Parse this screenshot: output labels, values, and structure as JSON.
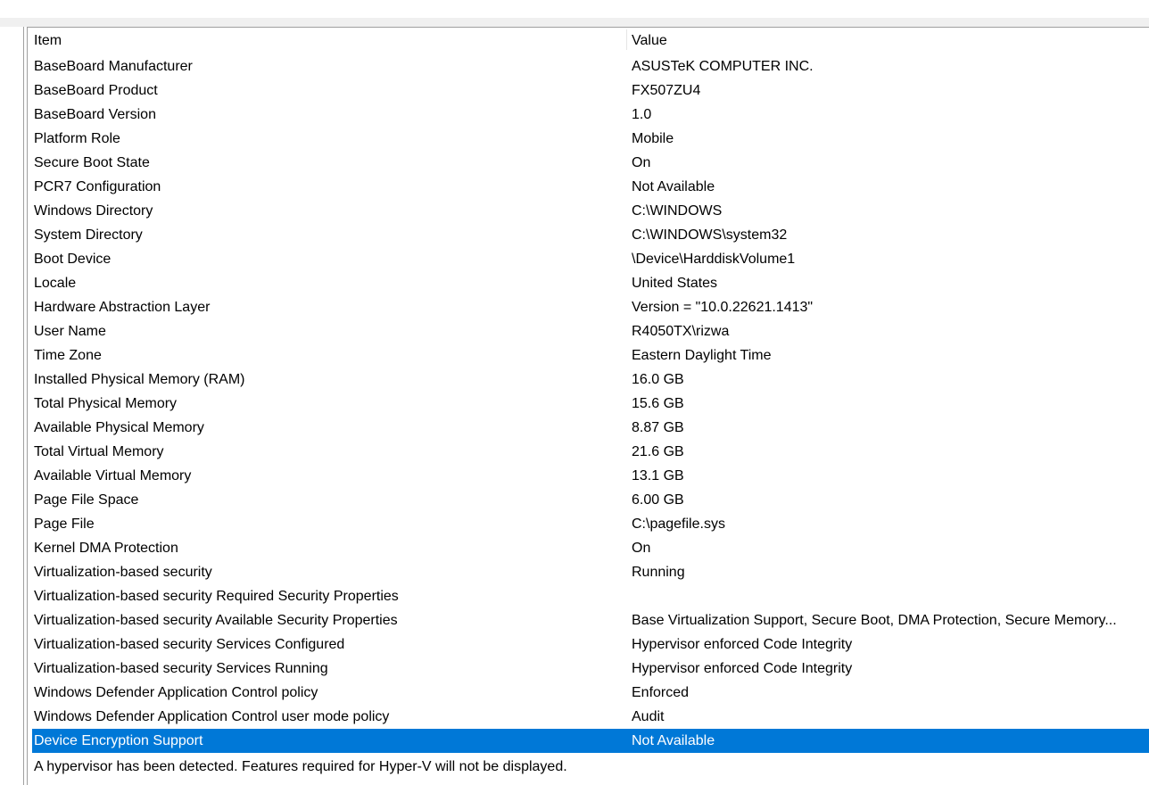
{
  "columns": {
    "item": "Item",
    "value": "Value"
  },
  "rows": [
    {
      "item": "BaseBoard Manufacturer",
      "value": "ASUSTeK COMPUTER INC."
    },
    {
      "item": "BaseBoard Product",
      "value": "FX507ZU4"
    },
    {
      "item": "BaseBoard Version",
      "value": "1.0"
    },
    {
      "item": "Platform Role",
      "value": "Mobile"
    },
    {
      "item": "Secure Boot State",
      "value": "On"
    },
    {
      "item": "PCR7 Configuration",
      "value": "Not Available"
    },
    {
      "item": "Windows Directory",
      "value": "C:\\WINDOWS"
    },
    {
      "item": "System Directory",
      "value": "C:\\WINDOWS\\system32"
    },
    {
      "item": "Boot Device",
      "value": "\\Device\\HarddiskVolume1"
    },
    {
      "item": "Locale",
      "value": "United States"
    },
    {
      "item": "Hardware Abstraction Layer",
      "value": "Version = \"10.0.22621.1413\""
    },
    {
      "item": "User Name",
      "value": "R4050TX\\rizwa"
    },
    {
      "item": "Time Zone",
      "value": "Eastern Daylight Time"
    },
    {
      "item": "Installed Physical Memory (RAM)",
      "value": "16.0 GB"
    },
    {
      "item": "Total Physical Memory",
      "value": "15.6 GB"
    },
    {
      "item": "Available Physical Memory",
      "value": "8.87 GB"
    },
    {
      "item": "Total Virtual Memory",
      "value": "21.6 GB"
    },
    {
      "item": "Available Virtual Memory",
      "value": "13.1 GB"
    },
    {
      "item": "Page File Space",
      "value": "6.00 GB"
    },
    {
      "item": "Page File",
      "value": "C:\\pagefile.sys"
    },
    {
      "item": "Kernel DMA Protection",
      "value": "On"
    },
    {
      "item": "Virtualization-based security",
      "value": "Running"
    },
    {
      "item": "Virtualization-based security Required Security Properties",
      "value": ""
    },
    {
      "item": "Virtualization-based security Available Security Properties",
      "value": "Base Virtualization Support, Secure Boot, DMA Protection, Secure Memory..."
    },
    {
      "item": "Virtualization-based security Services Configured",
      "value": "Hypervisor enforced Code Integrity"
    },
    {
      "item": "Virtualization-based security Services Running",
      "value": "Hypervisor enforced Code Integrity"
    },
    {
      "item": "Windows Defender Application Control policy",
      "value": "Enforced"
    },
    {
      "item": "Windows Defender Application Control user mode policy",
      "value": "Audit"
    },
    {
      "item": "Device Encryption Support",
      "value": "Not Available",
      "selected": true
    }
  ],
  "status_message": "A hypervisor has been detected. Features required for Hyper-V will not be displayed.",
  "colors": {
    "selection": "#0078d7",
    "selection_text": "#ffffff",
    "border": "#a0a0a0"
  }
}
